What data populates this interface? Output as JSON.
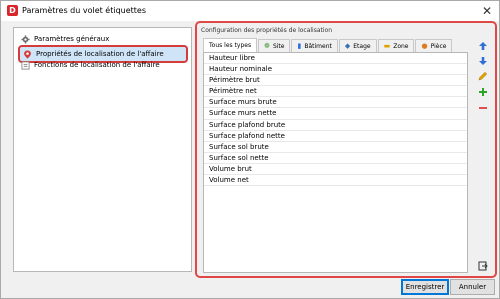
{
  "window": {
    "app_icon_letter": "D",
    "title": "Paramètres du volet étiquettes",
    "close_glyph": "✕"
  },
  "tree": {
    "items": [
      {
        "label": "Paramètres généraux",
        "icon": "gear-icon"
      },
      {
        "label": "Propriétés de localisation de l'affaire",
        "icon": "location-pin-icon",
        "selected": true
      },
      {
        "label": "Fonctions de localisation de l'affaire",
        "icon": "function-icon"
      }
    ]
  },
  "panel": {
    "title": "Configuration des propriétés de localisation",
    "tabs": [
      {
        "label": "Tous les types",
        "icon": "",
        "active": true
      },
      {
        "label": "Site",
        "icon": "site-icon"
      },
      {
        "label": "Bâtiment",
        "icon": "building-icon"
      },
      {
        "label": "Etage",
        "icon": "floor-icon"
      },
      {
        "label": "Zone",
        "icon": "zone-icon"
      },
      {
        "label": "Pièce",
        "icon": "room-icon"
      }
    ],
    "list": [
      "Hauteur libre",
      "Hauteur nominale",
      "Périmètre brut",
      "Périmètre net",
      "Surface murs brute",
      "Surface murs nette",
      "Surface plafond brute",
      "Surface plafond nette",
      "Surface sol brute",
      "Surface sol nette",
      "Volume brut",
      "Volume net"
    ]
  },
  "buttons": {
    "save": "Enregistrer",
    "cancel": "Annuler"
  },
  "colors": {
    "highlight_border": "#e04848",
    "selection_bg": "#cfe4f7",
    "up_arrow": "#2f6fd6",
    "edit": "#e0a000",
    "add": "#2aa52a",
    "remove": "#e05050"
  }
}
